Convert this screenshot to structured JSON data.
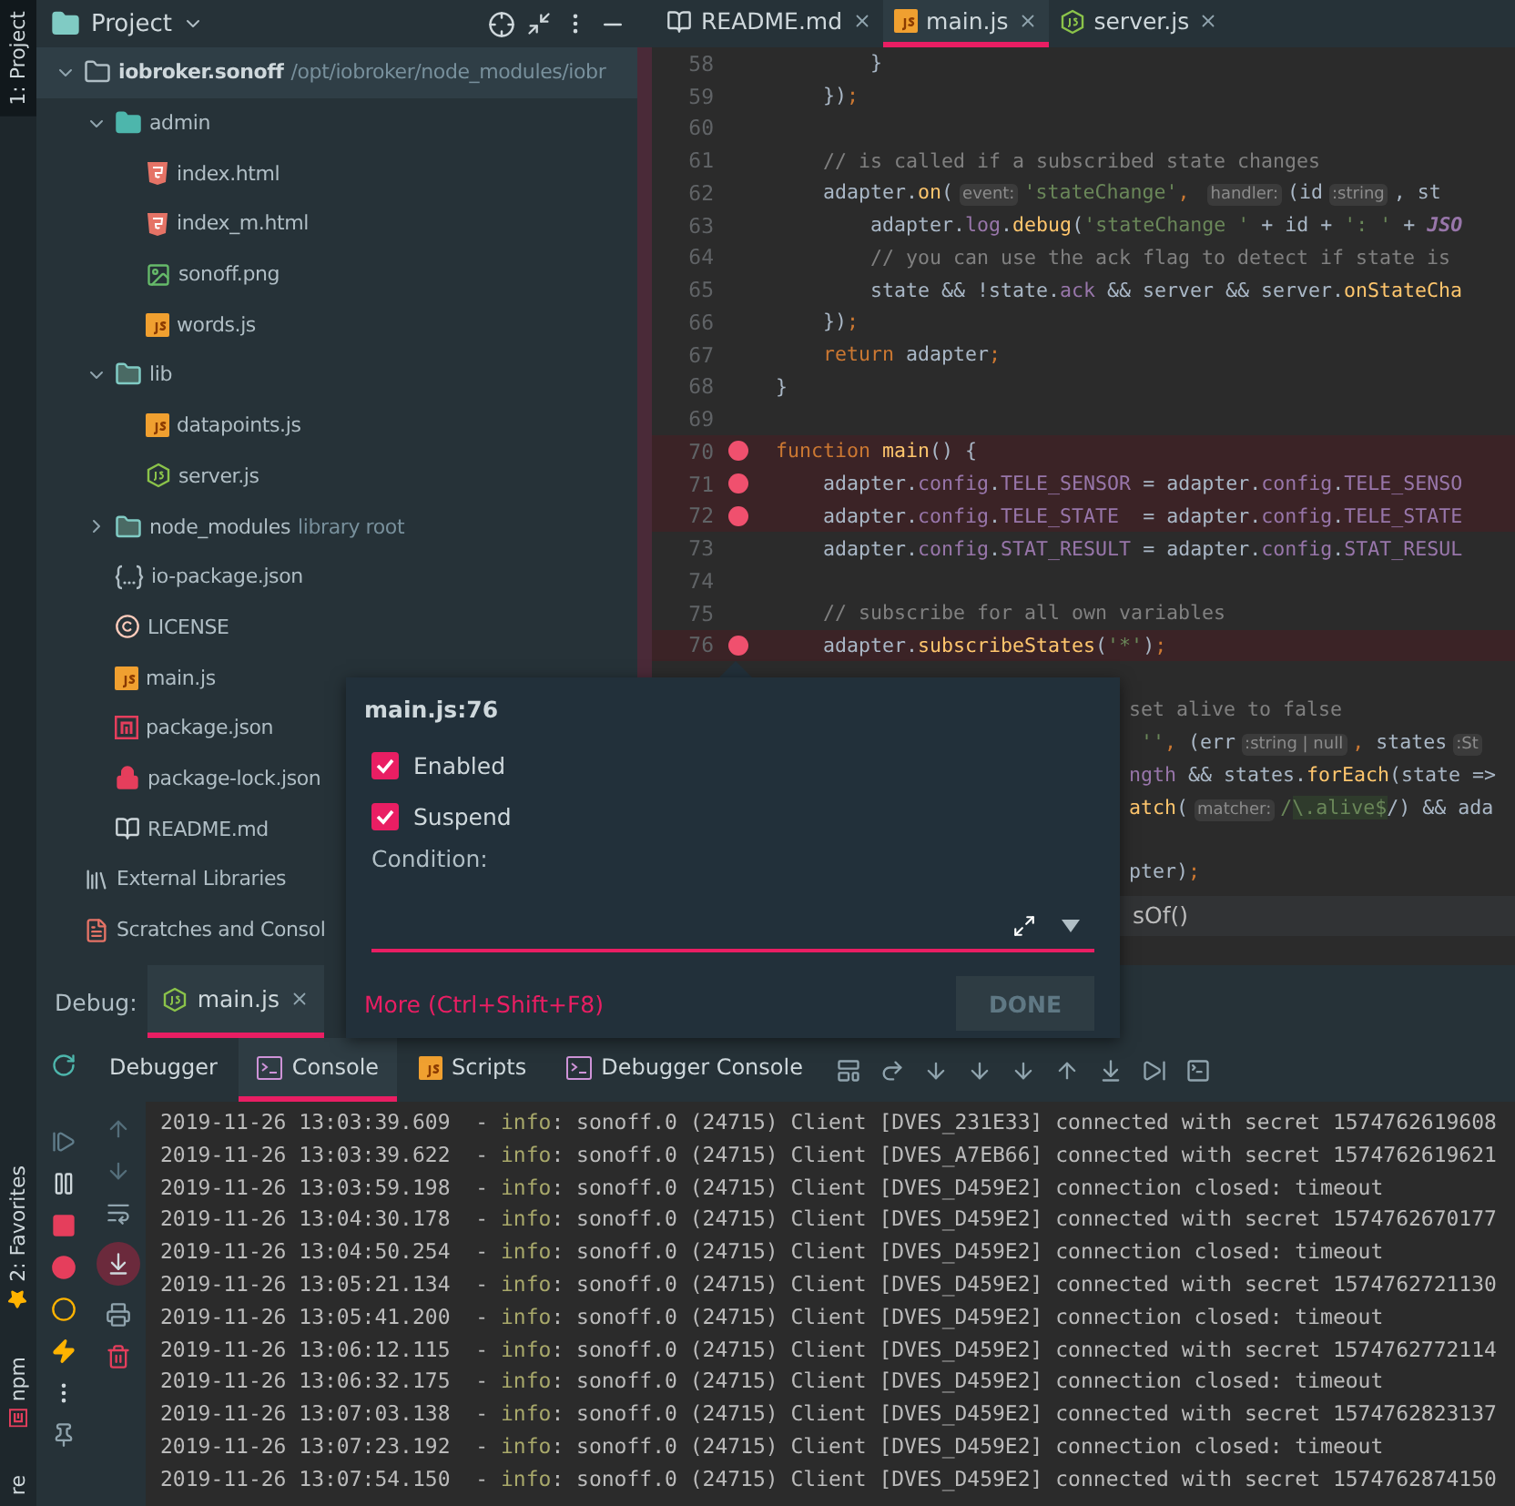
{
  "tool_strip": {
    "top": [
      {
        "label": "1: Project",
        "selected": true
      }
    ],
    "bottom": [
      {
        "label": "2: Favorites",
        "kind": "favorites"
      },
      {
        "label": "npm",
        "kind": "npm"
      },
      {
        "label": "re",
        "kind": "structure"
      }
    ]
  },
  "project": {
    "title": "Project",
    "tree": [
      {
        "name": "iobroker.sonoff",
        "detail": "/opt/iobroker/node_modules/iobr",
        "kind": "folder",
        "selected": true,
        "expanded": true,
        "children": [
          {
            "name": "admin",
            "kind": "web-folder",
            "selected": false,
            "expanded": true,
            "children": [
              {
                "name": "index.html",
                "kind": "html",
                "selected": false
              },
              {
                "name": "index_m.html",
                "kind": "html",
                "selected": false
              },
              {
                "name": "sonoff.png",
                "kind": "image",
                "selected": false
              },
              {
                "name": "words.js",
                "kind": "js",
                "selected": false
              }
            ]
          },
          {
            "name": "lib",
            "kind": "lib-folder",
            "selected": false,
            "expanded": true,
            "children": [
              {
                "name": "datapoints.js",
                "kind": "js",
                "selected": false
              },
              {
                "name": "server.js",
                "kind": "node",
                "selected": false
              }
            ]
          },
          {
            "name": "node_modules",
            "detail": "library root",
            "kind": "lib-folder",
            "selected": false,
            "expanded": false
          },
          {
            "name": "io-package.json",
            "kind": "json",
            "selected": false
          },
          {
            "name": "LICENSE",
            "kind": "license",
            "selected": false
          },
          {
            "name": "main.js",
            "kind": "js",
            "selected": false
          },
          {
            "name": "package.json",
            "kind": "npm",
            "selected": false
          },
          {
            "name": "package-lock.json",
            "kind": "lock",
            "selected": false
          },
          {
            "name": "README.md",
            "kind": "markdown",
            "selected": false
          }
        ]
      },
      {
        "name": "External Libraries",
        "kind": "libraries",
        "selected": false
      },
      {
        "name": "Scratches and Consol",
        "kind": "scratches",
        "selected": false
      }
    ]
  },
  "editor": {
    "tabs": [
      {
        "label": "README.md",
        "kind": "markdown",
        "selected": false
      },
      {
        "label": "main.js",
        "kind": "js",
        "selected": true
      },
      {
        "label": "server.js",
        "kind": "node",
        "selected": false
      }
    ],
    "lines": [
      {
        "number": "58",
        "breakpoint": false,
        "segments": [
          {
            "text": "        }",
            "kind": "plain"
          }
        ]
      },
      {
        "number": "59",
        "breakpoint": false,
        "segments": [
          {
            "text": "    })",
            "kind": "plain"
          },
          {
            "text": ";",
            "kind": "keyword"
          }
        ]
      },
      {
        "number": "60",
        "breakpoint": false
      },
      {
        "number": "61",
        "breakpoint": false,
        "segments": [
          {
            "text": "    // is called if a subscribed state changes",
            "kind": "comment"
          }
        ]
      },
      {
        "number": "62",
        "breakpoint": false,
        "segments": [
          {
            "text": "    adapter.",
            "kind": "plain"
          },
          {
            "text": "on",
            "kind": "fn"
          },
          {
            "text": "(",
            "kind": "plain"
          },
          {
            "text": "event:",
            "kind": "hint"
          },
          {
            "text": "'stateChange'",
            "kind": "string"
          },
          {
            "text": ", ",
            "kind": "keyword"
          },
          {
            "text": "handler:",
            "kind": "hint"
          },
          {
            "text": "(id",
            "kind": "plain"
          },
          {
            "text": ":string",
            "kind": "hint"
          },
          {
            "text": ", st",
            "kind": "plain"
          }
        ]
      },
      {
        "number": "63",
        "breakpoint": false,
        "segments": [
          {
            "text": "        adapter.",
            "kind": "plain"
          },
          {
            "text": "log",
            "kind": "prop"
          },
          {
            "text": ".",
            "kind": "plain"
          },
          {
            "text": "debug",
            "kind": "fn"
          },
          {
            "text": "(",
            "kind": "plain"
          },
          {
            "text": "'stateChange '",
            "kind": "string"
          },
          {
            "text": " + id + ",
            "kind": "plain"
          },
          {
            "text": "': '",
            "kind": "string"
          },
          {
            "text": " + ",
            "kind": "plain"
          },
          {
            "text": "JSO",
            "kind": "constant"
          }
        ]
      },
      {
        "number": "64",
        "breakpoint": false,
        "segments": [
          {
            "text": "        // you can use the ack flag to detect if state is",
            "kind": "comment"
          }
        ]
      },
      {
        "number": "65",
        "breakpoint": false,
        "segments": [
          {
            "text": "        state && !state.",
            "kind": "plain"
          },
          {
            "text": "ack",
            "kind": "prop"
          },
          {
            "text": " && server && server.",
            "kind": "plain"
          },
          {
            "text": "onStateCha",
            "kind": "fn"
          }
        ]
      },
      {
        "number": "66",
        "breakpoint": false,
        "segments": [
          {
            "text": "    })",
            "kind": "plain"
          },
          {
            "text": ";",
            "kind": "keyword"
          }
        ]
      },
      {
        "number": "67",
        "breakpoint": false,
        "segments": [
          {
            "text": "    return",
            "kind": "keyword"
          },
          {
            "text": " adapter",
            "kind": "plain"
          },
          {
            "text": ";",
            "kind": "keyword"
          }
        ]
      },
      {
        "number": "68",
        "breakpoint": false,
        "segments": [
          {
            "text": "}",
            "kind": "plain"
          }
        ]
      },
      {
        "number": "69",
        "breakpoint": false
      },
      {
        "number": "70",
        "breakpoint": true,
        "segments": [
          {
            "text": "function",
            "kind": "keyword"
          },
          {
            "text": " main",
            "kind": "fn"
          },
          {
            "text": "() {",
            "kind": "plain"
          }
        ]
      },
      {
        "number": "71",
        "breakpoint": true,
        "segments": [
          {
            "text": "    adapter.",
            "kind": "plain"
          },
          {
            "text": "config",
            "kind": "prop"
          },
          {
            "text": ".",
            "kind": "plain"
          },
          {
            "text": "TELE_SENSOR",
            "kind": "prop"
          },
          {
            "text": " = adapter.",
            "kind": "plain"
          },
          {
            "text": "config",
            "kind": "prop"
          },
          {
            "text": ".",
            "kind": "plain"
          },
          {
            "text": "TELE_SENSO",
            "kind": "prop"
          }
        ]
      },
      {
        "number": "72",
        "breakpoint": true,
        "segments": [
          {
            "text": "    adapter.",
            "kind": "plain"
          },
          {
            "text": "config",
            "kind": "prop"
          },
          {
            "text": ".",
            "kind": "plain"
          },
          {
            "text": "TELE_STATE",
            "kind": "prop"
          },
          {
            "text": "  = adapter.",
            "kind": "plain"
          },
          {
            "text": "config",
            "kind": "prop"
          },
          {
            "text": ".",
            "kind": "plain"
          },
          {
            "text": "TELE_STATE",
            "kind": "prop"
          }
        ]
      },
      {
        "number": "73",
        "breakpoint": false,
        "segments": [
          {
            "text": "    adapter.",
            "kind": "plain"
          },
          {
            "text": "config",
            "kind": "prop"
          },
          {
            "text": ".",
            "kind": "plain"
          },
          {
            "text": "STAT_RESULT",
            "kind": "prop"
          },
          {
            "text": " = adapter.",
            "kind": "plain"
          },
          {
            "text": "config",
            "kind": "prop"
          },
          {
            "text": ".",
            "kind": "plain"
          },
          {
            "text": "STAT_RESUL",
            "kind": "prop"
          }
        ]
      },
      {
        "number": "74",
        "breakpoint": false
      },
      {
        "number": "75",
        "breakpoint": false,
        "segments": [
          {
            "text": "    // subscribe for all own variables",
            "kind": "comment"
          }
        ]
      },
      {
        "number": "76",
        "breakpoint": true,
        "segments": [
          {
            "text": "    adapter.",
            "kind": "plain"
          },
          {
            "text": "subscribeStates",
            "kind": "fn"
          },
          {
            "text": "(",
            "kind": "plain"
          },
          {
            "text": "'*'",
            "kind": "string"
          },
          {
            "text": ")",
            "kind": "plain"
          },
          {
            "text": ";",
            "kind": "keyword"
          }
        ]
      },
      {
        "gap_before": true,
        "segments": [
          {
            "text": "set alive to false",
            "kind": "comment"
          }
        ]
      },
      {
        "segments": [
          {
            "text": " ''",
            "kind": "string"
          },
          {
            "text": ", ",
            "kind": "keyword"
          },
          {
            "text": "(err",
            "kind": "plain"
          },
          {
            "text": ":string | null",
            "kind": "hint"
          },
          {
            "text": ", ",
            "kind": "keyword"
          },
          {
            "text": "states",
            "kind": "plain"
          },
          {
            "text": ":St",
            "kind": "hint"
          }
        ]
      },
      {
        "segments": [
          {
            "text": "ngth",
            "kind": "prop"
          },
          {
            "text": " && states.",
            "kind": "plain"
          },
          {
            "text": "forEach",
            "kind": "fn"
          },
          {
            "text": "(state =>",
            "kind": "plain"
          }
        ]
      },
      {
        "segments": [
          {
            "text": "atch",
            "kind": "fn"
          },
          {
            "text": "(",
            "kind": "plain"
          },
          {
            "text": "matcher:",
            "kind": "hint"
          },
          {
            "text": "/",
            "kind": "string"
          },
          {
            "text": "\\.alive$",
            "kind": "regex"
          },
          {
            "text": "/) && ada",
            "kind": "plain"
          }
        ]
      },
      {
        "gap_before": true,
        "segments": [
          {
            "text": "pter)",
            "kind": "plain"
          },
          {
            "text": ";",
            "kind": "keyword"
          }
        ]
      }
    ],
    "breadcrumb": "sOf()"
  },
  "breakpoint_popup": {
    "title": "main.js:76",
    "options": [
      {
        "label": "Enabled",
        "checked": true
      },
      {
        "label": "Suspend",
        "checked": true
      }
    ],
    "condition_label": "Condition:",
    "more_link": "More (Ctrl+Shift+F8)",
    "done": {
      "label": "DONE",
      "disabled": true
    }
  },
  "debug": {
    "label": "Debug:",
    "tabs": [
      {
        "label": "main.js",
        "selected": true
      }
    ],
    "view_tabs": [
      {
        "label": "Debugger",
        "kind": "plain",
        "selected": false
      },
      {
        "label": "Console",
        "kind": "console",
        "selected": true
      },
      {
        "label": "Scripts",
        "kind": "js",
        "selected": false
      },
      {
        "label": "Debugger Console",
        "kind": "console",
        "selected": false
      }
    ]
  },
  "console": {
    "autoscroll": true,
    "lines": [
      {
        "time": "2019-11-26 13:03:39.609",
        "separator": "-",
        "level": "info",
        "message": ": sonoff.0 (24715) Client [DVES_231E33] connected with secret 1574762619608"
      },
      {
        "time": "2019-11-26 13:03:39.622",
        "separator": "-",
        "level": "info",
        "message": ": sonoff.0 (24715) Client [DVES_A7EB66] connected with secret 1574762619621"
      },
      {
        "time": "2019-11-26 13:03:59.198",
        "separator": "-",
        "level": "info",
        "message": ": sonoff.0 (24715) Client [DVES_D459E2] connection closed: timeout"
      },
      {
        "time": "2019-11-26 13:04:30.178",
        "separator": "-",
        "level": "info",
        "message": ": sonoff.0 (24715) Client [DVES_D459E2] connected with secret 1574762670177"
      },
      {
        "time": "2019-11-26 13:04:50.254",
        "separator": "-",
        "level": "info",
        "message": ": sonoff.0 (24715) Client [DVES_D459E2] connection closed: timeout"
      },
      {
        "time": "2019-11-26 13:05:21.134",
        "separator": "-",
        "level": "info",
        "message": ": sonoff.0 (24715) Client [DVES_D459E2] connected with secret 1574762721130"
      },
      {
        "time": "2019-11-26 13:05:41.200",
        "separator": "-",
        "level": "info",
        "message": ": sonoff.0 (24715) Client [DVES_D459E2] connection closed: timeout"
      },
      {
        "time": "2019-11-26 13:06:12.115",
        "separator": "-",
        "level": "info",
        "message": ": sonoff.0 (24715) Client [DVES_D459E2] connected with secret 1574762772114"
      },
      {
        "time": "2019-11-26 13:06:32.175",
        "separator": "-",
        "level": "info",
        "message": ": sonoff.0 (24715) Client [DVES_D459E2] connection closed: timeout"
      },
      {
        "time": "2019-11-26 13:07:03.138",
        "separator": "-",
        "level": "info",
        "message": ": sonoff.0 (24715) Client [DVES_D459E2] connected with secret 1574762823137"
      },
      {
        "time": "2019-11-26 13:07:23.192",
        "separator": "-",
        "level": "info",
        "message": ": sonoff.0 (24715) Client [DVES_D459E2] connection closed: timeout"
      },
      {
        "time": "2019-11-26 13:07:54.150",
        "separator": "-",
        "level": "info",
        "message": ": sonoff.0 (24715) Client [DVES_D459E2] connected with secret 1574762874150"
      }
    ]
  }
}
